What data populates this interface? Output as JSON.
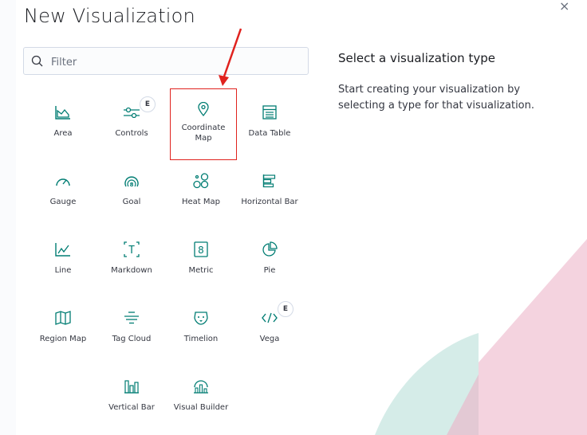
{
  "dialog": {
    "title": "New Visualization",
    "close_glyph": "×"
  },
  "search": {
    "placeholder": "Filter",
    "value": ""
  },
  "types": [
    {
      "label": "Area",
      "icon": "area-chart-icon"
    },
    {
      "label": "Controls",
      "icon": "controls-icon",
      "badge": "E"
    },
    {
      "label": "Coordinate Map",
      "icon": "map-pin-icon",
      "selected": true
    },
    {
      "label": "Data Table",
      "icon": "data-table-icon"
    },
    {
      "label": "Gauge",
      "icon": "gauge-icon"
    },
    {
      "label": "Goal",
      "icon": "goal-icon"
    },
    {
      "label": "Heat Map",
      "icon": "heat-map-icon"
    },
    {
      "label": "Horizontal Bar",
      "icon": "horizontal-bar-icon"
    },
    {
      "label": "Line",
      "icon": "line-chart-icon"
    },
    {
      "label": "Markdown",
      "icon": "markdown-icon"
    },
    {
      "label": "Metric",
      "icon": "metric-icon"
    },
    {
      "label": "Pie",
      "icon": "pie-chart-icon"
    },
    {
      "label": "Region Map",
      "icon": "region-map-icon"
    },
    {
      "label": "Tag Cloud",
      "icon": "tag-cloud-icon"
    },
    {
      "label": "Timelion",
      "icon": "timelion-icon"
    },
    {
      "label": "Vega",
      "icon": "vega-code-icon",
      "badge": "E"
    },
    {
      "label": "Vertical Bar",
      "icon": "vertical-bar-icon"
    },
    {
      "label": "Visual Builder",
      "icon": "visual-builder-icon"
    }
  ],
  "side_panel": {
    "title": "Select a visualization type",
    "description": "Start creating your visualization by selecting a type for that visualization."
  },
  "colors": {
    "accent": "#017d73",
    "selected_border": "#e0221e",
    "annotation_arrow": "#e0221e",
    "deco_teal": "#d5ece8",
    "deco_pink": "#f4d3df",
    "deco_mauve": "#e9c7d3"
  }
}
